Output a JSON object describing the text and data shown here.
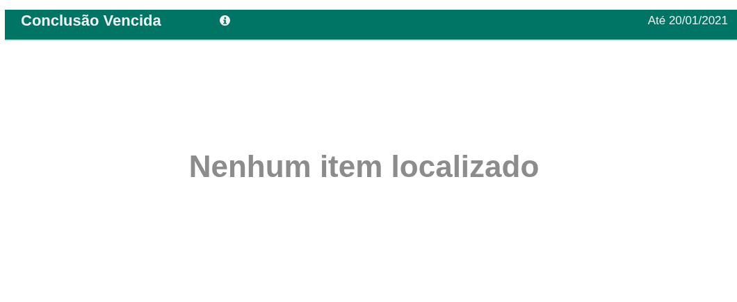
{
  "header": {
    "title": "Conclusão Vencida",
    "date": "Até 20/01/2021"
  },
  "empty_message": "Nenhum item localizado"
}
